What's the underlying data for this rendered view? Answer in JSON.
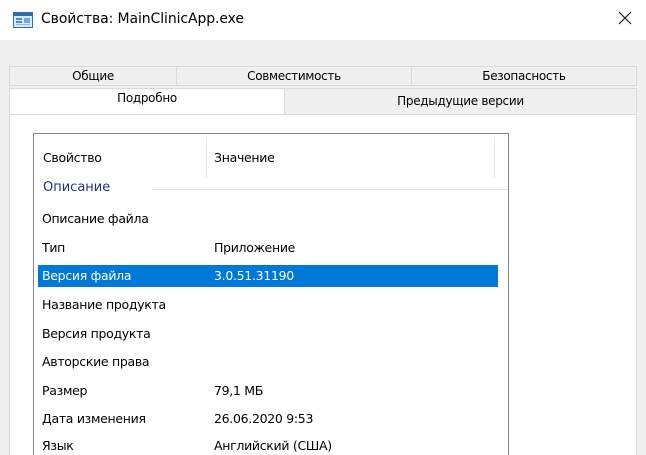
{
  "window": {
    "title": "Свойства: MainClinicApp.exe"
  },
  "tabs": {
    "row_back": [
      "Общие",
      "Совместимость",
      "Безопасность"
    ],
    "row_front": [
      "Подробно",
      "Предыдущие версии"
    ],
    "active": "Подробно"
  },
  "list": {
    "columns": [
      "Свойство",
      "Значение"
    ],
    "group": "Описание",
    "rows": [
      {
        "property": "Описание файла",
        "value": ""
      },
      {
        "property": "Тип",
        "value": "Приложение"
      },
      {
        "property": "Версия файла",
        "value": "3.0.51.31190",
        "selected": true
      },
      {
        "property": "Название продукта",
        "value": ""
      },
      {
        "property": "Версия продукта",
        "value": ""
      },
      {
        "property": "Авторские права",
        "value": ""
      },
      {
        "property": "Размер",
        "value": "79,1 МБ"
      },
      {
        "property": "Дата изменения",
        "value": "26.06.2020 9:53"
      },
      {
        "property": "Язык",
        "value": "Английский (США)"
      }
    ]
  },
  "colors": {
    "selection": "#0078d7",
    "group_label": "#1e3287",
    "dialog_background": "#f0f0f0"
  },
  "icons": [
    "application-icon",
    "close-icon"
  ]
}
